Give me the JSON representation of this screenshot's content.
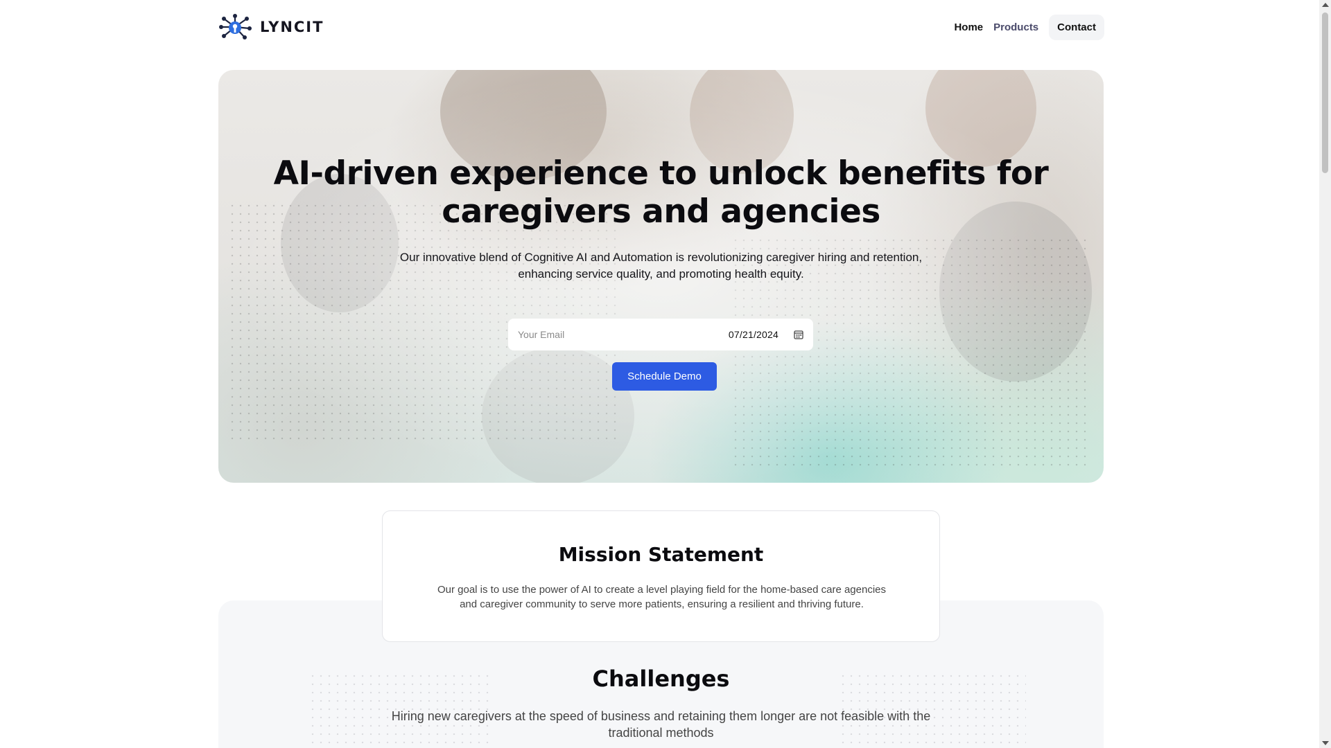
{
  "header": {
    "logo_text": "LYNCIT",
    "logo_icon": "network-node-icon",
    "nav": {
      "home": "Home",
      "products": "Products",
      "contact": "Contact"
    }
  },
  "hero": {
    "title_line1": "AI-driven experience to unlock benefits for",
    "title_line2": "caregivers and agencies",
    "subtitle_line1": "Our innovative blend of Cognitive AI and Automation is revolutionizing caregiver hiring and retention,",
    "subtitle_line2": "enhancing service quality, and promoting health equity.",
    "email_placeholder": "Your Email",
    "date_value": "07/21/2024",
    "date_icon": "calendar-icon",
    "cta_label": "Schedule Demo",
    "cta_color": "#2d5be3"
  },
  "mission": {
    "title": "Mission Statement",
    "text_line1": "Our goal is to use the power of AI to create a level playing field for the home-based care agencies",
    "text_line2": "and caregiver community to serve more patients, ensuring a resilient and thriving future."
  },
  "challenges": {
    "title": "Challenges",
    "text_line1": "Hiring new caregivers at the speed of business and retaining them longer are not feasible with the",
    "text_line2": "traditional methods"
  }
}
